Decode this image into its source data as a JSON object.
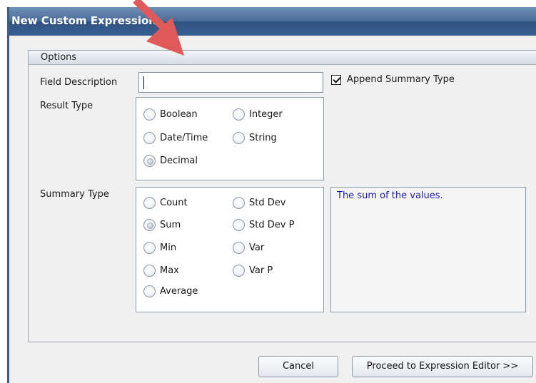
{
  "window": {
    "title": "New Custom Expression"
  },
  "options": {
    "header": "Options",
    "field_description_label": "Field Description",
    "field_description_value": "",
    "append_summary_label": "Append Summary Type",
    "append_summary_checked": true,
    "result_type_label": "Result Type",
    "result_types": [
      {
        "label": "Boolean",
        "selected": false
      },
      {
        "label": "Integer",
        "selected": false
      },
      {
        "label": "Date/Time",
        "selected": false
      },
      {
        "label": "String",
        "selected": false
      },
      {
        "label": "Decimal",
        "selected": true
      }
    ],
    "summary_type_label": "Summary Type",
    "summary_types": [
      {
        "label": "Count",
        "selected": false
      },
      {
        "label": "Std Dev",
        "selected": false
      },
      {
        "label": "Sum",
        "selected": true
      },
      {
        "label": "Std Dev P",
        "selected": false
      },
      {
        "label": "Min",
        "selected": false
      },
      {
        "label": "Var",
        "selected": false
      },
      {
        "label": "Max",
        "selected": false
      },
      {
        "label": "Var P",
        "selected": false
      },
      {
        "label": "Average",
        "selected": false
      }
    ],
    "summary_description": "The sum of the values."
  },
  "buttons": {
    "cancel": "Cancel",
    "proceed": "Proceed to Expression Editor >>"
  },
  "annotation": {
    "arrow_color": "#e05a5a"
  }
}
